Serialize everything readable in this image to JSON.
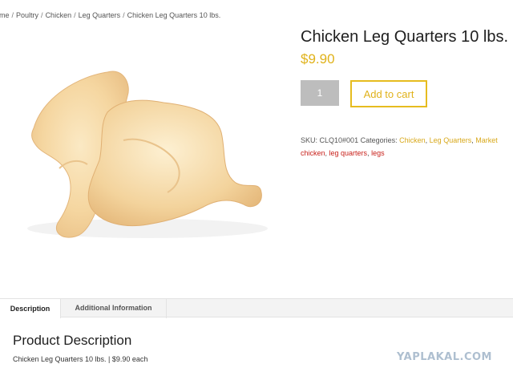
{
  "breadcrumb": {
    "items": [
      "ome",
      "Poultry",
      "Chicken",
      "Leg Quarters",
      "Chicken Leg Quarters 10 lbs."
    ],
    "separator": "/"
  },
  "product": {
    "image_alt": "chicken leg quarters photo",
    "title": "Chicken Leg Quarters 10 lbs.",
    "price": "$9.90",
    "quantity": "1",
    "add_to_cart_label": "Add to cart",
    "sku_label": "SKU:",
    "sku": "CLQ10#001",
    "categories_label": "Categories:",
    "categories": [
      "Chicken",
      "Leg Quarters",
      "Market"
    ],
    "tags": [
      "chicken",
      "leg quarters",
      "legs"
    ]
  },
  "tabs": [
    {
      "label": "Description",
      "active": true
    },
    {
      "label": "Additional Information",
      "active": false
    }
  ],
  "description": {
    "heading": "Product Description",
    "text": "Chicken Leg Quarters 10 lbs. | $9.90 each"
  },
  "watermark": "YAPLAKAL.COM",
  "colors": {
    "accent": "#e0b21a",
    "tag": "#c8201a",
    "button_bg": "#bdbdbd"
  }
}
